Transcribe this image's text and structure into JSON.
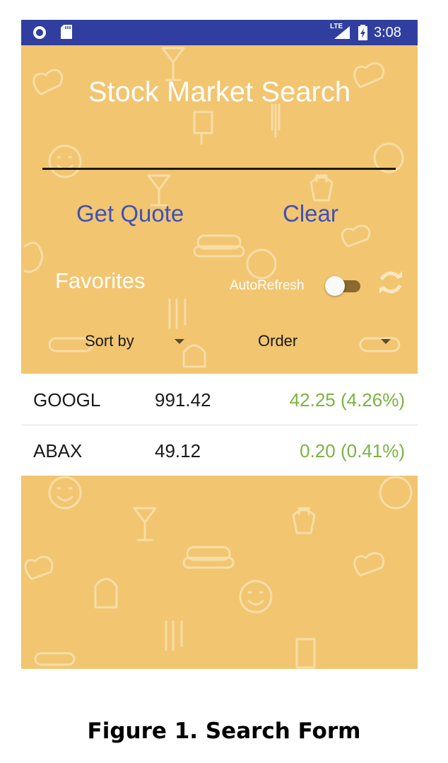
{
  "status_bar": {
    "network": "LTE",
    "time": "3:08",
    "icons": [
      "record-icon",
      "sd-card-icon",
      "signal-icon",
      "battery-charging-icon"
    ]
  },
  "app": {
    "title": "Stock Market Search",
    "search_value": "",
    "buttons": {
      "get_quote": "Get Quote",
      "clear": "Clear"
    },
    "favorites": {
      "label": "Favorites",
      "autorefresh_label": "AutoRefresh",
      "autorefresh_on": false,
      "refresh_icon": "refresh-icon"
    },
    "sort": {
      "sort_by": "Sort by",
      "order": "Order"
    },
    "favorites_list": [
      {
        "symbol": "GOOGL",
        "price": "991.42",
        "change": "42.25 (4.26%)"
      },
      {
        "symbol": "ABAX",
        "price": "49.12",
        "change": "0.20 (0.41%)"
      }
    ],
    "colors": {
      "background": "#f2c571",
      "status_bar": "#303f9f",
      "button_text": "#3f51b5",
      "positive_change": "#7cb342"
    }
  },
  "caption": "Figure 1. Search Form"
}
